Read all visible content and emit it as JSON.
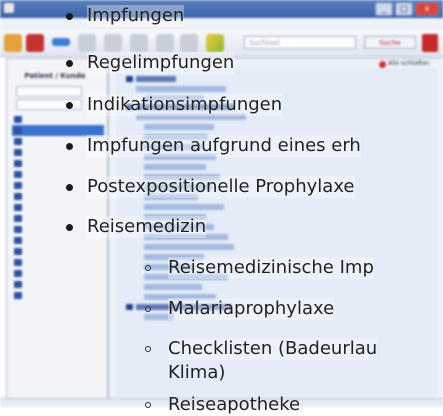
{
  "window": {
    "title": "",
    "buttons": [
      "_",
      "□",
      "x"
    ]
  },
  "toolbar": {
    "search_placeholder": "Suchtext",
    "search_button": "Suche"
  },
  "left_panel": {
    "patient_label": "Patient / Kunde",
    "close_label": "Alle schließen"
  },
  "overlay_list": {
    "level1": [
      "Impfungen",
      "Regelimpfungen",
      "Indikationsimpfungen",
      "Impfungen aufgrund eines erh",
      "Postexpositionelle Prophylaxe",
      "Reisemedizin"
    ],
    "level2": [
      "Reisemedizinische Imp",
      "Malariaprophylaxe",
      "Checklisten (Badeurlau",
      "Klima)",
      "Reiseapotheke"
    ]
  },
  "colors": {
    "accent": "#3b73d1",
    "nav_icon": "#2c4fa0",
    "close_red": "#d0312d"
  }
}
